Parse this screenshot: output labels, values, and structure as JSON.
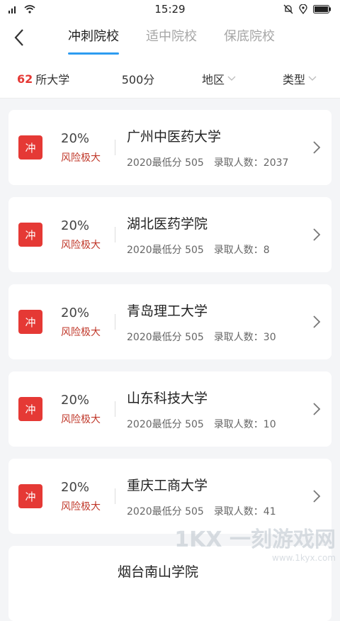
{
  "status": {
    "time": "15:29"
  },
  "tabs": [
    {
      "label": "冲刺院校",
      "active": true
    },
    {
      "label": "适中院校",
      "active": false
    },
    {
      "label": "保底院校",
      "active": false
    }
  ],
  "filters": {
    "count_num": "62",
    "count_suffix": "所大学",
    "score": "500分",
    "region": "地区",
    "type": "类型"
  },
  "colors": {
    "accent": "#2d9cf0",
    "badge": "#e53935",
    "risk": "#c0392b"
  },
  "colleges": [
    {
      "badge": "冲",
      "pct": "20%",
      "risk": "风险极大",
      "name": "广州中医药大学",
      "min_score": "2020最低分 505",
      "admit": "录取人数：2037"
    },
    {
      "badge": "冲",
      "pct": "20%",
      "risk": "风险极大",
      "name": "湖北医药学院",
      "min_score": "2020最低分 505",
      "admit": "录取人数：8"
    },
    {
      "badge": "冲",
      "pct": "20%",
      "risk": "风险极大",
      "name": "青岛理工大学",
      "min_score": "2020最低分 505",
      "admit": "录取人数：30"
    },
    {
      "badge": "冲",
      "pct": "20%",
      "risk": "风险极大",
      "name": "山东科技大学",
      "min_score": "2020最低分 505",
      "admit": "录取人数：10"
    },
    {
      "badge": "冲",
      "pct": "20%",
      "risk": "风险极大",
      "name": "重庆工商大学",
      "min_score": "2020最低分 505",
      "admit": "录取人数：41"
    },
    {
      "badge": "",
      "pct": "",
      "risk": "",
      "name": "烟台南山学院",
      "min_score": "",
      "admit": ""
    }
  ],
  "watermark": {
    "text": "1KX 一刻游戏网",
    "url": "www.1kyx.com"
  }
}
